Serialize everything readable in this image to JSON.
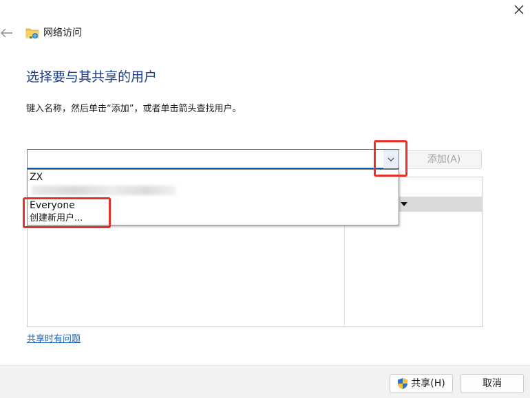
{
  "window": {
    "title": "网络访问",
    "close_icon": "close-icon",
    "back_icon": "back-arrow-icon",
    "title_icon": "network-folder-icon"
  },
  "main": {
    "heading": "选择要与其共享的用户",
    "instruction": "键入名称，然后单击“添加”，或者单击箭头查找用户。",
    "combo": {
      "value": "",
      "dropdown_icon": "chevron-down-icon"
    },
    "add_button": "添加(A)",
    "dropdown_items": [
      {
        "label": "ZX"
      },
      {
        "label": "Everyone"
      },
      {
        "label": "创建新用户..."
      }
    ],
    "help_link": "共享时有问题"
  },
  "footer": {
    "share_button": "共享(H)",
    "share_icon": "uac-shield-icon",
    "cancel_button": "取消"
  },
  "colors": {
    "heading": "#1c3d8c",
    "link": "#1a63b8",
    "highlight": "#e8302a",
    "focus_border": "#0b5fb3"
  }
}
